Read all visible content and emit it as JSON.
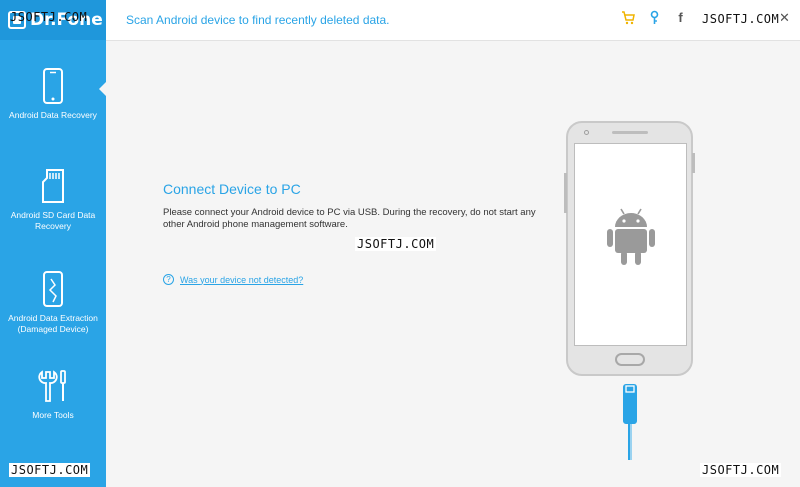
{
  "app": {
    "logo_text": "Dr.Fone",
    "subtitle": "Scan Android device to find recently deleted data."
  },
  "sidebar": {
    "items": [
      {
        "label": "Android Data Recovery",
        "icon": "phone-icon",
        "active": true
      },
      {
        "label": "Android SD Card Data Recovery",
        "icon": "sd-card-icon",
        "active": false
      },
      {
        "label": "Android Data Extraction (Damaged Device)",
        "icon": "broken-phone-icon",
        "active": false
      },
      {
        "label": "More Tools",
        "icon": "tools-icon",
        "active": false
      }
    ]
  },
  "header_icons": [
    "cart-icon",
    "key-icon",
    "facebook-icon",
    "twitter-icon",
    "menu-icon",
    "minimize-icon",
    "close-icon"
  ],
  "main": {
    "title": "Connect Device to PC",
    "description": "Please connect your Android device to PC via USB. During the recovery, do not start any other Android phone management software.",
    "help_link": "Was your device not detected?"
  },
  "watermarks": {
    "top_right": "JSOFTJ.COM",
    "top_left": "JSOFTJ.COM",
    "center": "JSOFTJ.COM",
    "bottom_left": "JSOFTJ.COM",
    "bottom_right": "JSOFTJ.COM"
  },
  "colors": {
    "accent": "#2aa4e6",
    "sidebar": "#2aa4e6",
    "background": "#f5f5f5",
    "android_gray": "#9a9a9a",
    "cable": "#2aa4e6"
  }
}
